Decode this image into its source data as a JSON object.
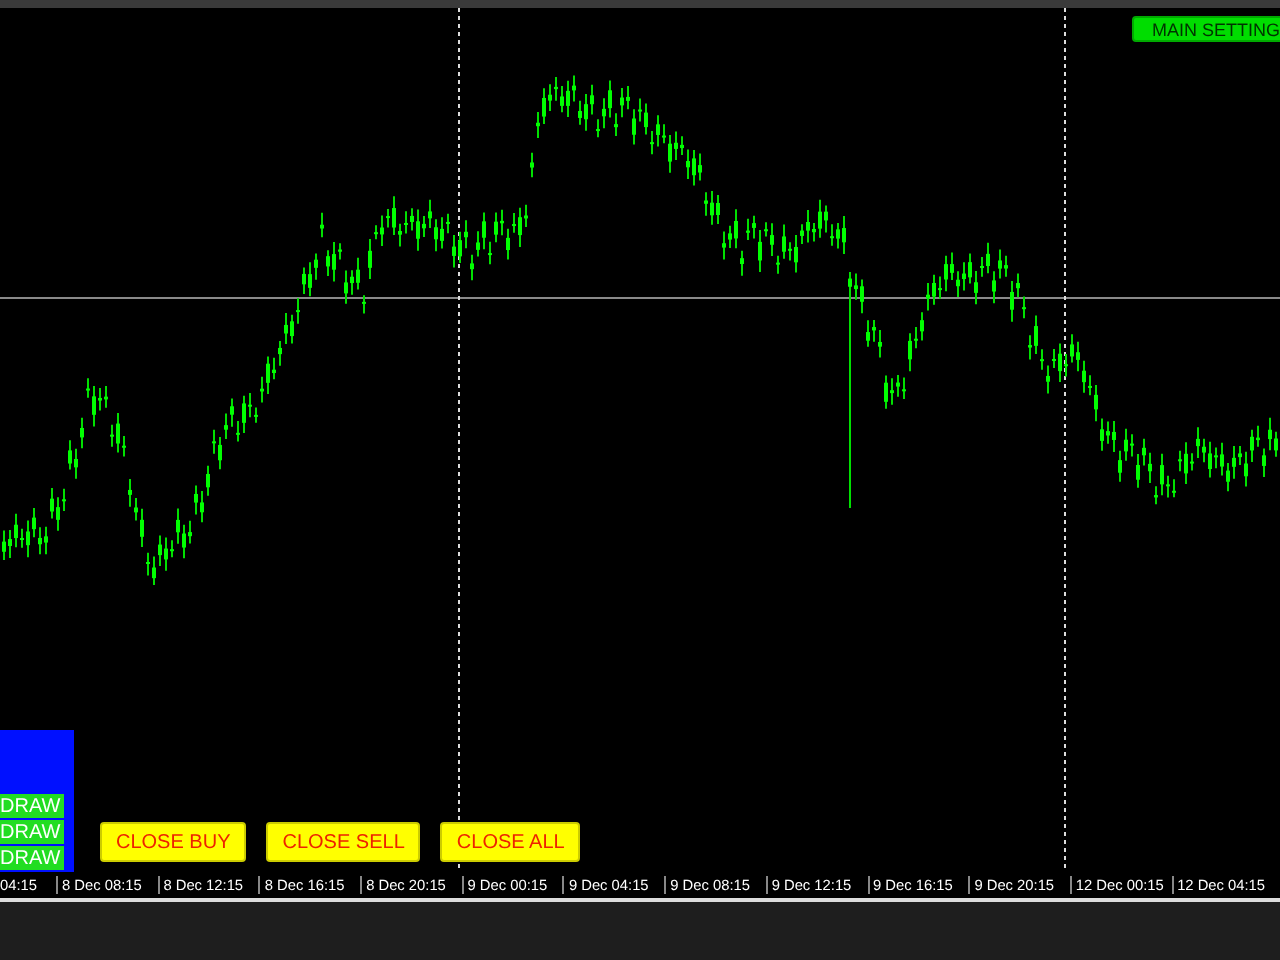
{
  "top_right_button": {
    "label": "MAIN SETTING"
  },
  "side_panel": {
    "buttons": [
      "DRAW",
      "DRAW",
      "DRAW"
    ]
  },
  "trade_buttons": [
    "CLOSE BUY",
    "CLOSE SELL",
    "CLOSE ALL"
  ],
  "time_axis": {
    "labels": [
      "04:15",
      "8 Dec 08:15",
      "8 Dec 12:15",
      "8 Dec 16:15",
      "8 Dec 20:15",
      "9 Dec 00:15",
      "9 Dec 04:15",
      "9 Dec 08:15",
      "9 Dec 12:15",
      "9 Dec 16:15",
      "9 Dec 20:15",
      "12 Dec 00:15",
      "12 Dec 04:15"
    ]
  }
}
